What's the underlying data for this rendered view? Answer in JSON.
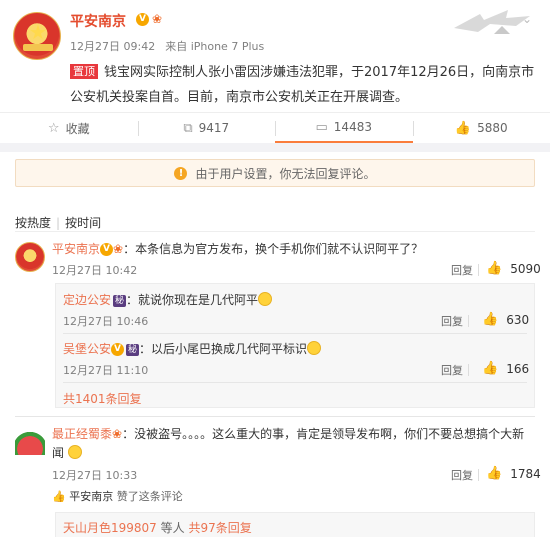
{
  "post": {
    "author": "平安南京",
    "time": "12月27日 09:42",
    "source": "来自 iPhone 7 Plus",
    "pin_label": "置顶",
    "text": "钱宝网实际控制人张小雷因涉嫌违法犯罪，于2017年12月26日，向南京市公安机关投案自首。目前，南京市公安机关正在开展调查。"
  },
  "actions": {
    "favorite": "收藏",
    "repost": "9417",
    "comment": "14483",
    "like": "5880"
  },
  "notice": "由于用户设置，你无法回复评论。",
  "sort": {
    "hot": "按热度",
    "time": "按时间"
  },
  "comments": [
    {
      "user": "平安南京",
      "text": "：本条信息为官方发布，换个手机你们就不认识阿平了？",
      "time": "12月27日 10:42",
      "reply": "回复",
      "likes": "5090",
      "subs": [
        {
          "user": "定边公安",
          "badge": "秘",
          "text": "：就说你现在是几代阿平",
          "time": "12月27日 10:46",
          "reply": "回复",
          "likes": "630"
        },
        {
          "user": "吴堡公安",
          "badge": "秘",
          "text": "：以后小尾巴换成几代阿平标识",
          "time": "12月27日 11:10",
          "reply": "回复",
          "likes": "166"
        }
      ],
      "more": "共1401条回复"
    },
    {
      "user": "最正经蜀黍",
      "text": "：没被盗号。。。。这么重大的事，肯定是领导发布啊，你们不要总想搞个大新闻",
      "time": "12月27日 10:33",
      "reply": "回复",
      "likes": "1784",
      "liked_by": "平安南京",
      "liked_suffix": "赞了这条评论",
      "sub_preview_user": "天山月色199807",
      "sub_preview_mid": "等人",
      "sub_preview_more": "共97条回复"
    }
  ],
  "colors": {
    "accent": "#eb7350",
    "title": "#e44d2f",
    "pin": "#e8383d"
  }
}
